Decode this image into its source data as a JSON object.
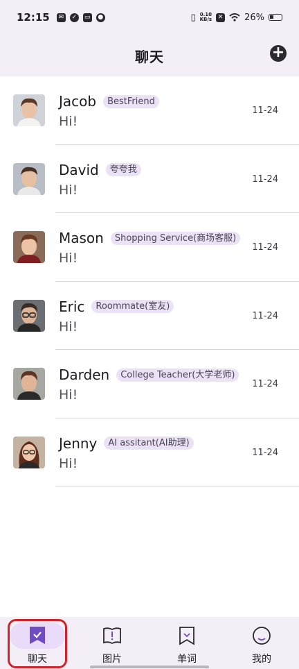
{
  "status_bar": {
    "time": "12:15",
    "net_speed_top": "0.10",
    "net_speed_bottom": "KB/s",
    "battery": "26%"
  },
  "header": {
    "title": "聊天",
    "add_icon": "plus-circle-icon"
  },
  "chats": [
    {
      "name": "Jacob",
      "tag": "BestFriend",
      "message": "Hi!",
      "date": "11-24"
    },
    {
      "name": "David",
      "tag": "夸夸我",
      "message": "Hi!",
      "date": "11-24"
    },
    {
      "name": "Mason",
      "tag": "Shopping Service(商场客服)",
      "message": "Hi!",
      "date": "11-24"
    },
    {
      "name": "Eric",
      "tag": "Roommate(室友)",
      "message": "Hi!",
      "date": "11-24"
    },
    {
      "name": "Darden",
      "tag": "College Teacher(大学老师)",
      "message": "Hi!",
      "date": "11-24"
    },
    {
      "name": "Jenny",
      "tag": "AI assitant(AI助理)",
      "message": "Hi!",
      "date": "11-24"
    }
  ],
  "nav": [
    {
      "label": "聊天",
      "icon": "chat-bookmark-check-icon",
      "active": true
    },
    {
      "label": "图片",
      "icon": "image-book-icon",
      "active": false
    },
    {
      "label": "单词",
      "icon": "word-bookmark-icon",
      "active": false
    },
    {
      "label": "我的",
      "icon": "profile-circle-icon",
      "active": false
    }
  ],
  "colors": {
    "accent": "#6f4cc4",
    "background_tint": "#f4eff6",
    "tag_bg": "#ebe2f5",
    "highlight": "#d2232a"
  }
}
